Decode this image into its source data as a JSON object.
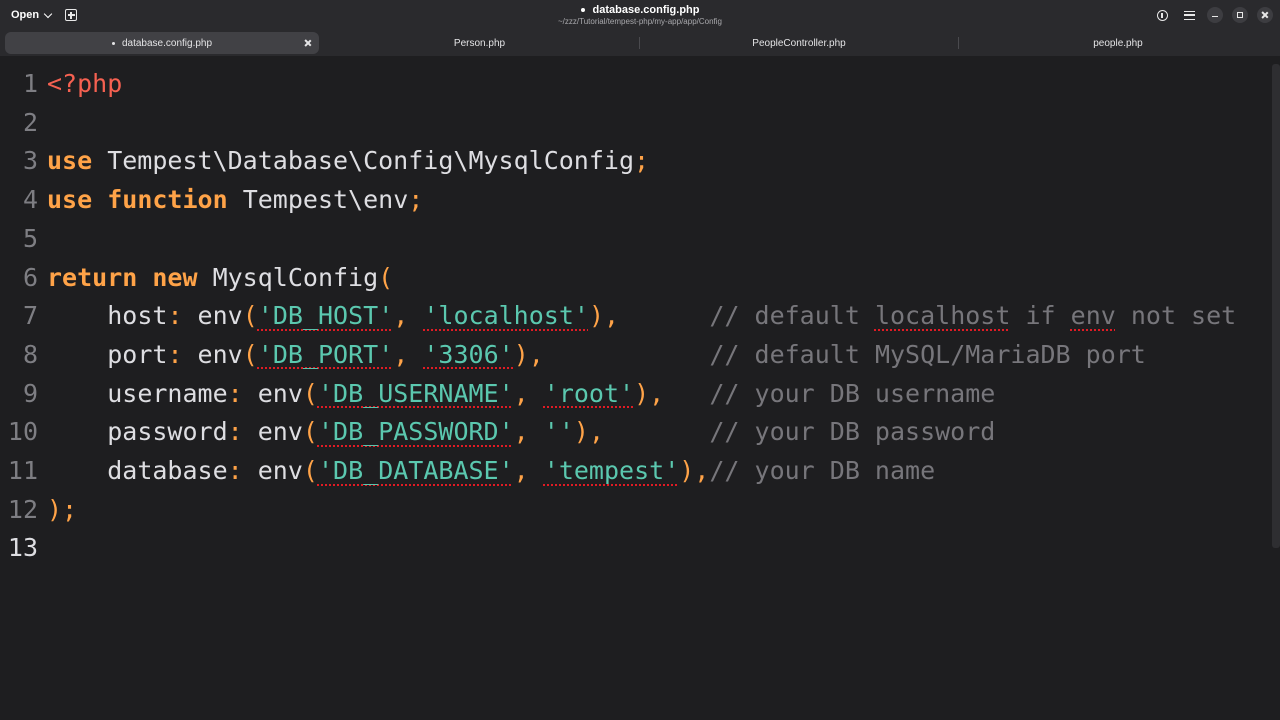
{
  "header": {
    "open_label": "Open",
    "title": "database.config.php",
    "subtitle": "~/zzz/Tutorial/tempest-php/my-app/app/Config"
  },
  "tabs": [
    {
      "label": "database.config.php",
      "active": true,
      "modified": true
    },
    {
      "label": "Person.php",
      "active": false
    },
    {
      "label": "PeopleController.php",
      "active": false
    },
    {
      "label": "people.php",
      "active": false
    }
  ],
  "editor": {
    "current_line": 13,
    "line_numbers": [
      "1",
      "2",
      "3",
      "4",
      "5",
      "6",
      "7",
      "8",
      "9",
      "10",
      "11",
      "12",
      "13"
    ],
    "lines": {
      "l1": {
        "open_tag": "<?php"
      },
      "l3": {
        "kw": "use",
        "ns": " Tempest\\Database\\Config\\MysqlConfig",
        "semi": ";"
      },
      "l4": {
        "kw1": "use",
        "kw2": "function",
        "ns": " Tempest\\env",
        "semi": ";"
      },
      "l6": {
        "kw1": "return",
        "kw2": "new",
        "cls": " MysqlConfig",
        "paren": "("
      },
      "l7": {
        "name": "host",
        "colon": ":",
        "fn": " env",
        "open": "(",
        "s1": "'DB_HOST'",
        "comma": ",",
        "s2": "'localhost'",
        "close": "),",
        "pad": "      ",
        "c1": "// default ",
        "c2": "localhost",
        "c3": " if ",
        "c4": "env",
        "c5": " not set"
      },
      "l8": {
        "name": "port",
        "colon": ":",
        "fn": " env",
        "open": "(",
        "s1": "'DB_PORT'",
        "comma": ",",
        "s2": "'3306'",
        "close": "),",
        "pad": "           ",
        "comment": "// default MySQL/MariaDB port"
      },
      "l9": {
        "name": "username",
        "colon": ":",
        "fn": " env",
        "open": "(",
        "s1": "'DB_USERNAME'",
        "comma": ",",
        "s2": "'root'",
        "close": "),",
        "pad": "   ",
        "comment": "// your DB username"
      },
      "l10": {
        "name": "password",
        "colon": ":",
        "fn": " env",
        "open": "(",
        "s1": "'DB_PASSWORD'",
        "comma": ",",
        "s2": "''",
        "close": "),",
        "pad": "       ",
        "comment": "// your DB password"
      },
      "l11": {
        "name": "database",
        "colon": ":",
        "fn": " env",
        "open": "(",
        "s1": "'DB_DATABASE'",
        "comma": ",",
        "s2": "'tempest'",
        "close": "),",
        "comment": "// your DB name"
      },
      "l12": {
        "close": ");"
      }
    }
  },
  "colors": {
    "background": "#1e1e20",
    "keyword": "#ffa348",
    "string": "#5bc8af",
    "comment": "#77767b",
    "php_tag": "#f66151"
  },
  "icons": [
    "chevron-down-icon",
    "new-tab-icon",
    "info-icon",
    "menu-icon",
    "minimize-icon",
    "maximize-icon",
    "close-icon"
  ]
}
